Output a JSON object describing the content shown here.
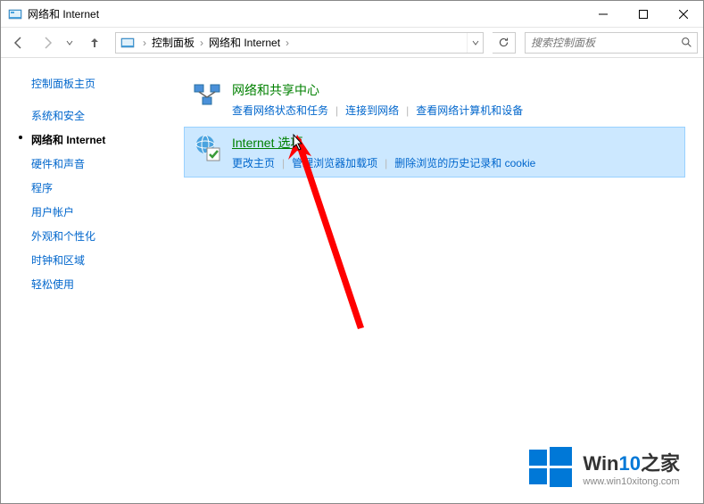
{
  "window": {
    "title": "网络和 Internet"
  },
  "breadcrumb": {
    "items": [
      "控制面板",
      "网络和 Internet"
    ]
  },
  "search": {
    "placeholder": "搜索控制面板"
  },
  "sidebar": {
    "title": "控制面板主页",
    "items": [
      {
        "label": "系统和安全",
        "active": false
      },
      {
        "label": "网络和 Internet",
        "active": true
      },
      {
        "label": "硬件和声音",
        "active": false
      },
      {
        "label": "程序",
        "active": false
      },
      {
        "label": "用户帐户",
        "active": false
      },
      {
        "label": "外观和个性化",
        "active": false
      },
      {
        "label": "时钟和区域",
        "active": false
      },
      {
        "label": "轻松使用",
        "active": false
      }
    ]
  },
  "categories": [
    {
      "title": "网络和共享中心",
      "highlighted": false,
      "links": [
        "查看网络状态和任务",
        "连接到网络",
        "查看网络计算机和设备"
      ]
    },
    {
      "title": "Internet 选项",
      "highlighted": true,
      "links": [
        "更改主页",
        "管理浏览器加载项",
        "删除浏览的历史记录和 cookie"
      ]
    }
  ],
  "watermark": {
    "brand_prefix": "Win",
    "brand_accent": "10",
    "brand_suffix": "之家",
    "url": "www.win10xitong.com"
  }
}
